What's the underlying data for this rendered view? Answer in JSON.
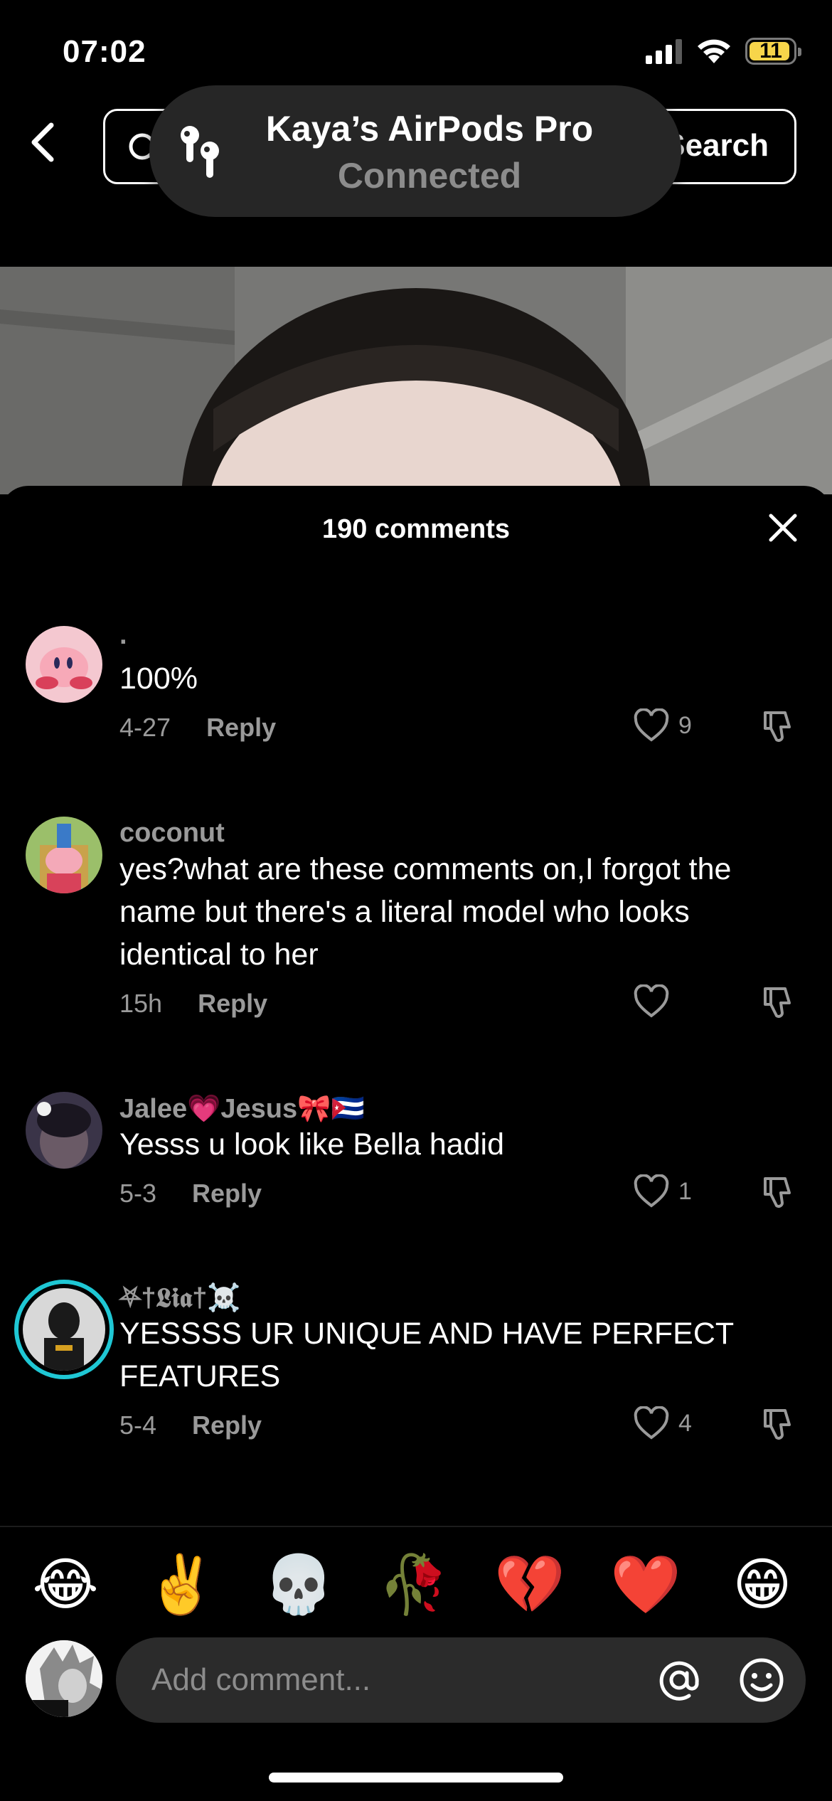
{
  "status_bar": {
    "time": "07:02",
    "battery": "11"
  },
  "header": {
    "search_button": "Search"
  },
  "airpods": {
    "title": "Kaya’s AirPods Pro",
    "status": "Connected"
  },
  "comments_sheet": {
    "title": "190 comments",
    "comments": [
      {
        "name": "·",
        "text": "100%",
        "date": "4-27",
        "reply": "Reply",
        "likes": "9"
      },
      {
        "name": "coconut",
        "text": "yes?what are these comments on,I forgot the name but there's a literal model who looks identical to her",
        "date": "15h",
        "reply": "Reply",
        "likes": ""
      },
      {
        "name": "Jalee💗Jesus🎀🇨🇺",
        "text": "Yesss u look like Bella hadid",
        "date": "5-3",
        "reply": "Reply",
        "likes": "1"
      },
      {
        "name": "⛧†𝕷𝖎𝖆†☠️",
        "text": "YESSSS UR UNIQUE AND HAVE PERFECT FEATURES",
        "date": "5-4",
        "reply": "Reply",
        "likes": "4"
      }
    ]
  },
  "emoji_bar": [
    "😂",
    "✌️",
    "💀",
    "🥀",
    "💔",
    "❤️",
    "😁"
  ],
  "composer": {
    "placeholder": "Add comment..."
  },
  "colors": {
    "background": "#000000",
    "muted_text": "#9a9a9a",
    "input_bg": "#2b2b2b",
    "story_ring": "#1fc7d4",
    "battery": "#f7d54a"
  }
}
